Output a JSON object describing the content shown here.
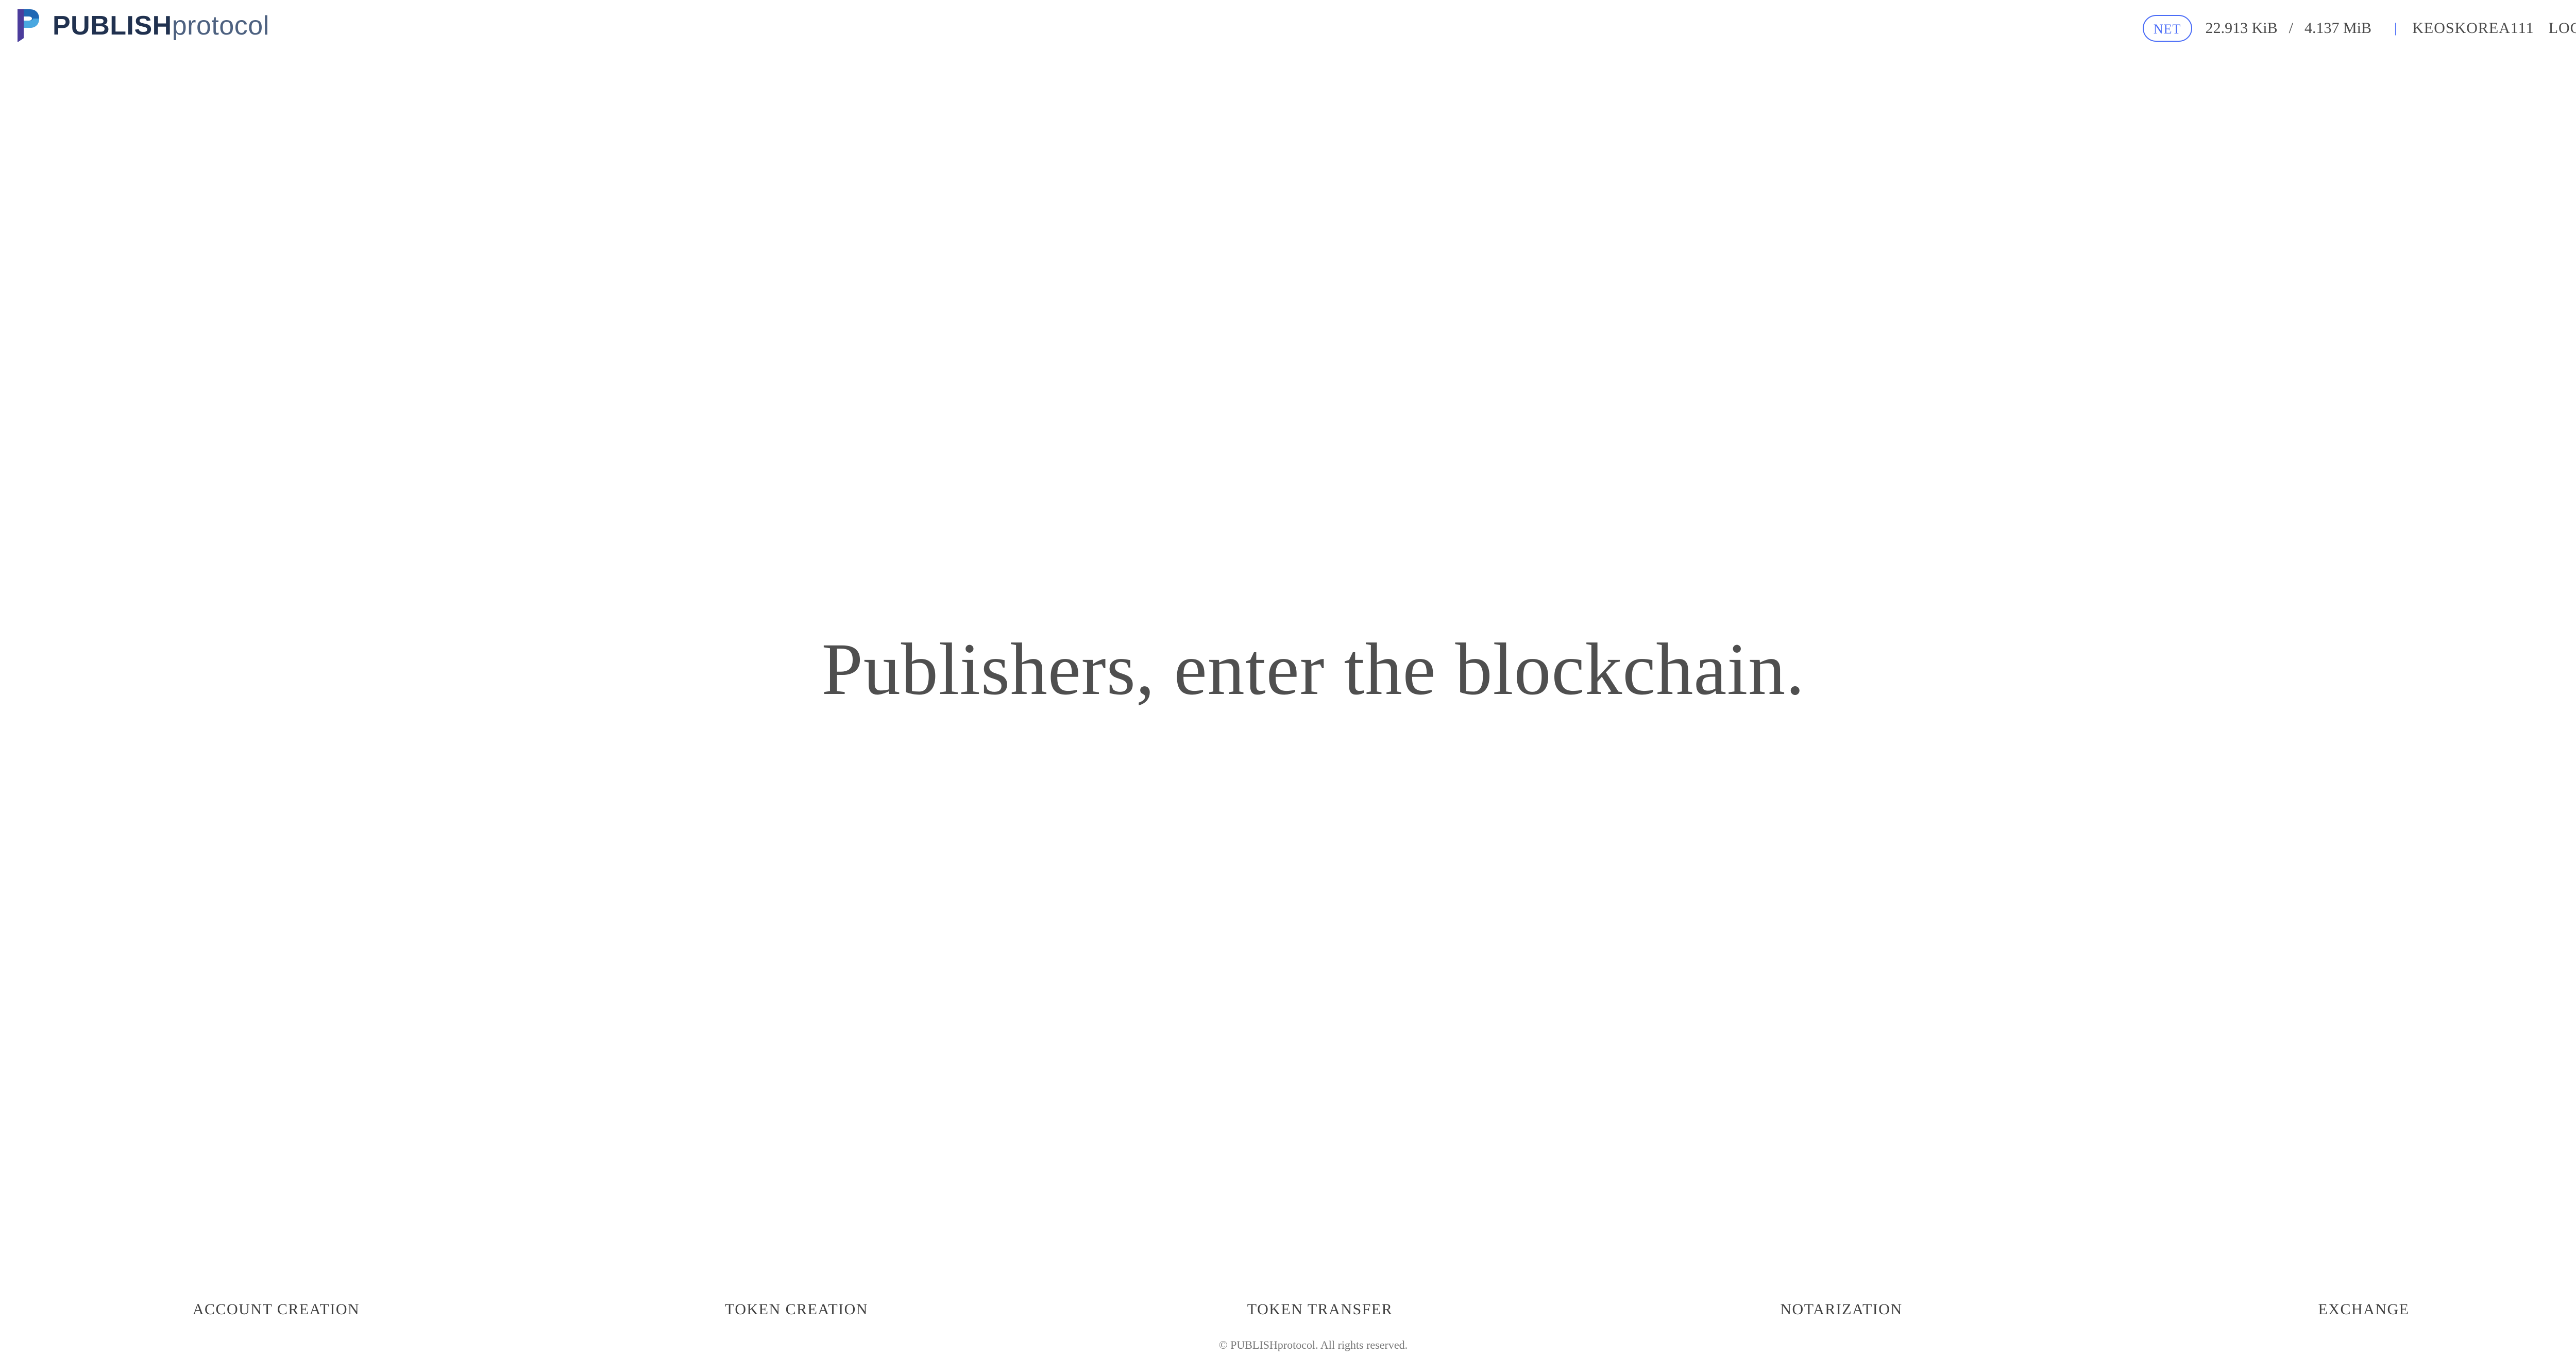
{
  "header": {
    "brand": {
      "strong": "PUBLISH",
      "light": "protocol"
    },
    "resource_toggle": "NET",
    "usage_used": "22.913 KiB",
    "usage_separator": "/",
    "usage_limit": "4.137 MiB",
    "divider": "|",
    "account_name": "KEOSKOREA111",
    "logout_label": "LOGOUT",
    "icons": {
      "logo": "publish-protocol-logo-icon"
    }
  },
  "hero": {
    "headline": "Publishers, enter the blockchain."
  },
  "nav": {
    "items": [
      {
        "label": "ACCOUNT CREATION"
      },
      {
        "label": "TOKEN CREATION"
      },
      {
        "label": "TOKEN TRANSFER"
      },
      {
        "label": "NOTARIZATION"
      },
      {
        "label": "EXCHANGE"
      }
    ]
  },
  "footer": {
    "copyright": "© PUBLISHprotocol. All rights reserved."
  },
  "colors": {
    "brand_dark": "#20314f",
    "brand_light": "#4d6180",
    "accent_blue": "#4a6cf7",
    "text": "#4f4f4f",
    "logo_blue": "#1f67b4",
    "logo_light_blue": "#49a7e0",
    "logo_purple": "#4b3c9c"
  }
}
